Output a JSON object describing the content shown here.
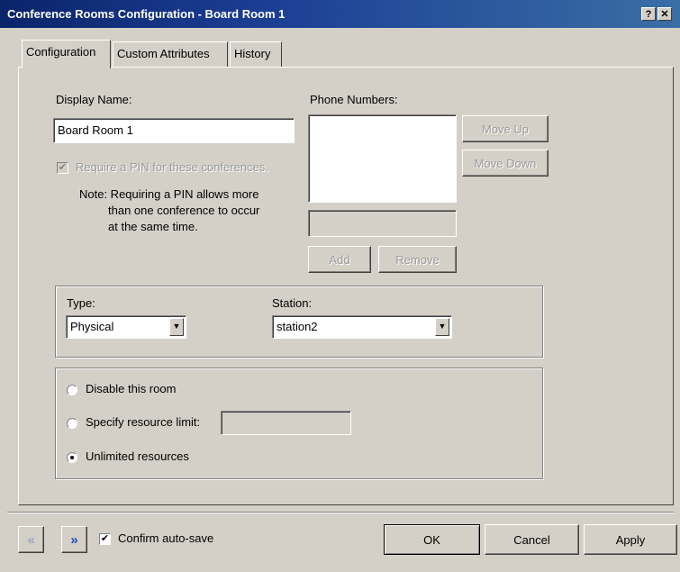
{
  "window": {
    "title": "Conference Rooms Configuration - Board Room 1",
    "help_label": "?",
    "close_label": "✕"
  },
  "tabs": [
    {
      "label": "Configuration",
      "active": true
    },
    {
      "label": "Custom Attributes",
      "active": false
    },
    {
      "label": "History",
      "active": false
    }
  ],
  "config": {
    "display_name_label": "Display Name:",
    "display_name_value": "Board Room 1",
    "require_pin_label": "Require a PIN for these conferences.",
    "require_pin_checked": true,
    "note_line1": "Note: Requiring a PIN allows more",
    "note_line2": "than one conference to occur",
    "note_line3": "at the same time.",
    "phone_numbers_label": "Phone Numbers:",
    "move_up_label": "Move Up",
    "move_down_label": "Move Down",
    "add_label": "Add",
    "remove_label": "Remove",
    "type_label": "Type:",
    "type_value": "Physical",
    "station_label": "Station:",
    "station_value": "station2",
    "disable_room_label": "Disable this room",
    "specify_limit_label": "Specify resource limit:",
    "unlimited_label": "Unlimited resources",
    "selected_resource_option": "Unlimited resources"
  },
  "footer": {
    "back_icon": "double-chevron-left",
    "forward_icon": "double-chevron-right",
    "confirm_autosave_label": "Confirm auto-save",
    "confirm_autosave_checked": true,
    "ok_label": "OK",
    "cancel_label": "Cancel",
    "apply_label": "Apply"
  },
  "colors": {
    "title_bar": "#0a246a",
    "dialog_bg": "#d4d0c8",
    "nav_forward_accent": "#1f4fbf"
  }
}
